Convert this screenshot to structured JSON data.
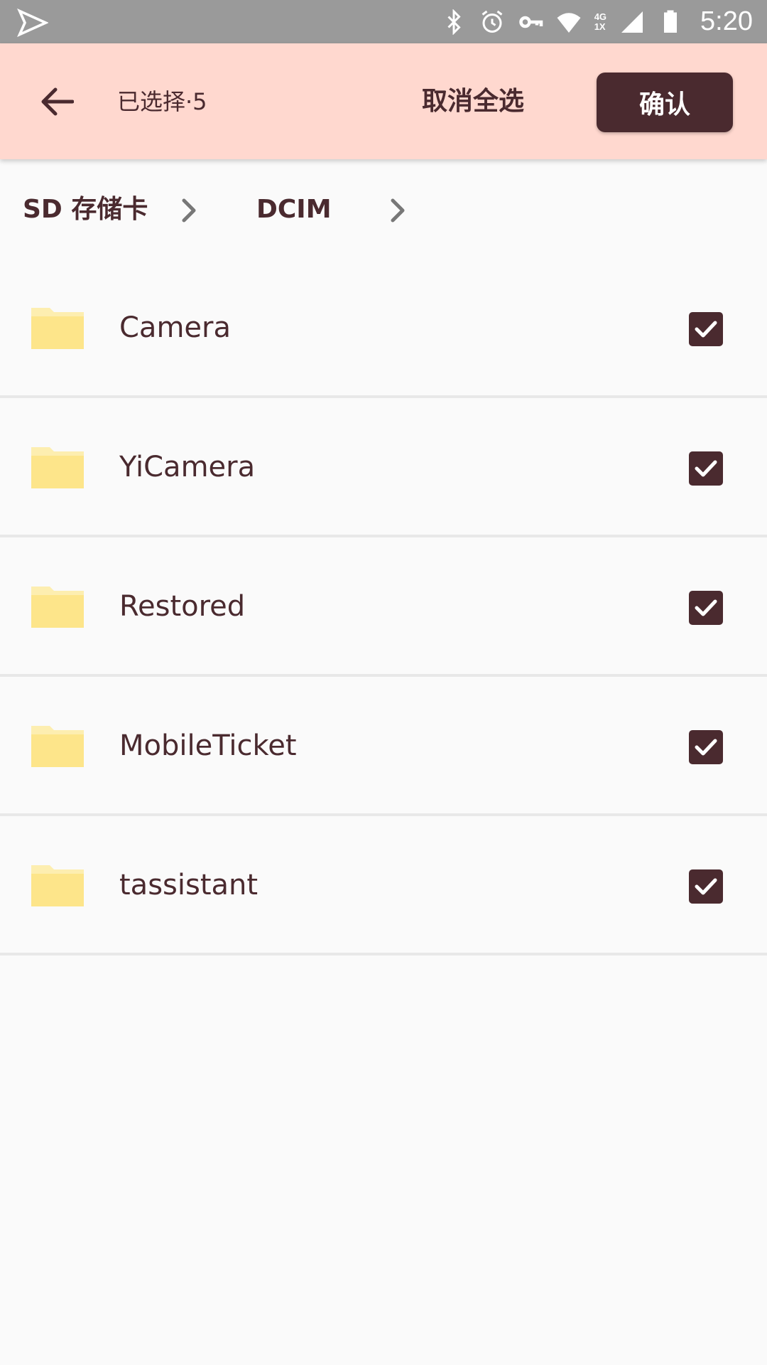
{
  "status_bar": {
    "time": "5:20",
    "network_top": "4G",
    "network_bottom": "1X",
    "icons": [
      "send-icon",
      "bluetooth-icon",
      "alarm-icon",
      "vpn-key-icon",
      "wifi-icon",
      "signal-icon",
      "battery-icon"
    ]
  },
  "app_bar": {
    "back_icon": "arrow-back-icon",
    "selected_label": "已选择·5",
    "deselect_all_label": "取消全选",
    "confirm_label": "确认",
    "background_color": "#ffd8cf",
    "accent_color": "#4a2a2f"
  },
  "breadcrumb": {
    "items": [
      {
        "label": "SD 存储卡"
      },
      {
        "label": "DCIM"
      }
    ],
    "separator_icon": "chevron-right-icon"
  },
  "folders": [
    {
      "name": "Camera",
      "checked": true
    },
    {
      "name": "YiCamera",
      "checked": true
    },
    {
      "name": "Restored",
      "checked": true
    },
    {
      "name": "MobileTicket",
      "checked": true
    },
    {
      "name": "tassistant",
      "checked": true
    }
  ],
  "folder_icon_color": "#fde58a"
}
